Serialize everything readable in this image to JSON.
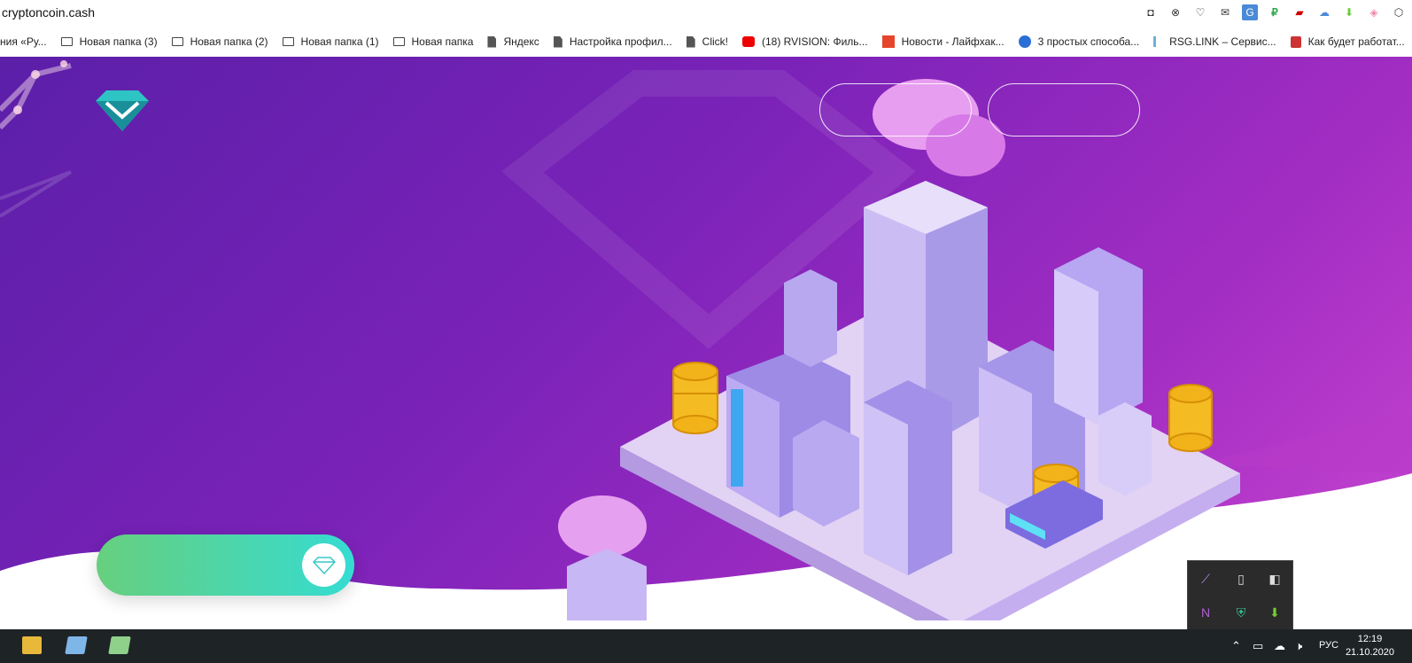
{
  "browser": {
    "url": "cryptoncoin.cash",
    "bookmarks": [
      {
        "label": "ния «Ру...",
        "icon": "none"
      },
      {
        "label": "Новая папка (3)",
        "icon": "folder-icon"
      },
      {
        "label": "Новая папка (2)",
        "icon": "folder-icon"
      },
      {
        "label": "Новая папка (1)",
        "icon": "folder-icon"
      },
      {
        "label": "Новая папка",
        "icon": "folder-icon"
      },
      {
        "label": "Яндекс",
        "icon": "page-icon"
      },
      {
        "label": "Настройка профил...",
        "icon": "page-icon"
      },
      {
        "label": "Click!",
        "icon": "page-icon"
      },
      {
        "label": "(18) RVISION: Филь...",
        "icon": "youtube-icon"
      },
      {
        "label": "Новости - Лайфхак...",
        "icon": "lifehacker-icon"
      },
      {
        "label": "3 простых способа...",
        "icon": "ucoz-icon"
      },
      {
        "label": "RSG.LINK – Сервис...",
        "icon": "rsg-icon"
      },
      {
        "label": "Как будет работат...",
        "icon": "gift-icon"
      }
    ]
  },
  "colors": {
    "hero_start": "#5b1fa8",
    "hero_end": "#c847d0",
    "cta_start": "#67cf7e",
    "cta_end": "#35dcd2"
  },
  "taskbar": {
    "time": "12:19",
    "date": "21.10.2020",
    "lang": "РУС"
  }
}
